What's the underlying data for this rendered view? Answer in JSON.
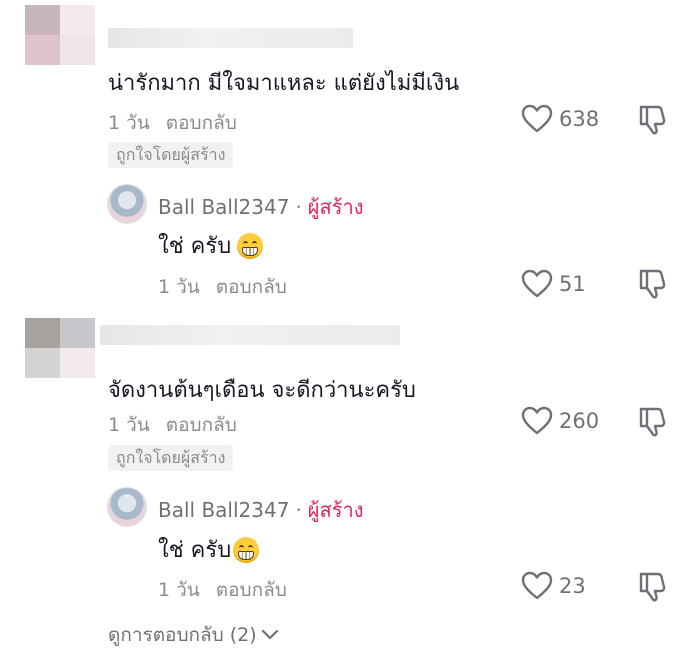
{
  "comments": [
    {
      "text": "น่ารักมาก มีใจมาแหละ แต่ยังไม่มีเงิน",
      "time": "1 วัน",
      "reply_label": "ตอบกลับ",
      "liked_badge": "ถูกใจโดยผู้สร้าง",
      "likes": "638",
      "avatar_colors": [
        "#c9b6bc",
        "#f4eaee",
        "#dfc5cb",
        "#f0e4e8"
      ],
      "reply": {
        "author": "Ball Ball2347",
        "separator": "·",
        "creator_label": "ผู้สร้าง",
        "text": "ใช่ ครับ",
        "time": "1 วัน",
        "reply_label": "ตอบกลับ",
        "likes": "51"
      }
    },
    {
      "text": "จัดงานต้นๆเดือน จะดีกว่านะครับ",
      "time": "1 วัน",
      "reply_label": "ตอบกลับ",
      "liked_badge": "ถูกใจโดยผู้สร้าง",
      "likes": "260",
      "avatar_colors": [
        "#a8a29f",
        "#c6c6cb",
        "#d4d4d4",
        "#f3ebeb"
      ],
      "reply": {
        "author": "Ball Ball2347",
        "separator": "·",
        "creator_label": "ผู้สร้าง",
        "text": "ใช่ ครับ",
        "time": "1 วัน",
        "reply_label": "ตอบกลับ",
        "likes": "23"
      }
    }
  ],
  "view_replies": "ดูการตอบกลับ (2)",
  "icons": {
    "like": "heart-outline-icon",
    "dislike": "thumbs-down-icon",
    "emoji": "grinning-face-emoji",
    "expand": "chevron-down-icon"
  },
  "colors": {
    "creator": "#e0245e",
    "secondary_text": "#8a8b91",
    "primary_text": "#161823"
  }
}
